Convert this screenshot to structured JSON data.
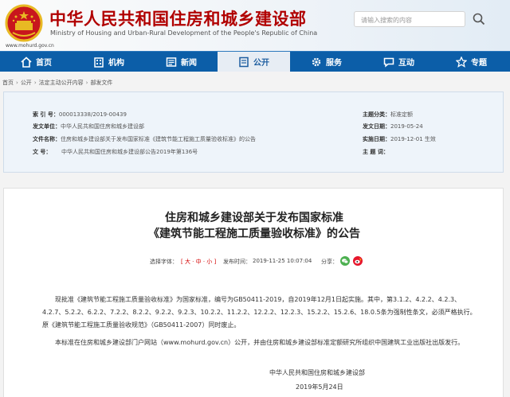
{
  "header": {
    "title": "中华人民共和国住房和城乡建设部",
    "subtitle": "Ministry of Housing and Urban-Rural Development of the People's Republic of China",
    "url": "www.mohurd.gov.cn",
    "search_placeholder": "请输入搜索的内容"
  },
  "nav": {
    "items": [
      {
        "label": "首页",
        "icon": "home-icon"
      },
      {
        "label": "机构",
        "icon": "building-icon"
      },
      {
        "label": "新闻",
        "icon": "news-icon"
      },
      {
        "label": "公开",
        "icon": "document-icon",
        "active": true
      },
      {
        "label": "服务",
        "icon": "gear-icon"
      },
      {
        "label": "互动",
        "icon": "chat-icon"
      },
      {
        "label": "专题",
        "icon": "star-icon"
      }
    ]
  },
  "breadcrumb": [
    "首页",
    "公开",
    "法定主动公开内容",
    "部发文件"
  ],
  "info": {
    "index_label": "索 引 号：",
    "index_value": "000013338/2019-00439",
    "issuer_label": "发文单位：",
    "issuer_value": "中华人民共和国住房和城乡建设部",
    "filename_label": "文件名称：",
    "filename_value": "住房和城乡建设部关于发布国家标准《建筑节能工程施工质量验收标准》的公告",
    "docno_label": "文 号：",
    "docno_value": "中华人民共和国住房和城乡建设部公告2019年第136号",
    "category_label": "主题分类：",
    "category_value": "标准定额",
    "date_label": "发文日期：",
    "date_value": "2019-05-24",
    "effective_label": "实施日期：",
    "effective_value": "2019-12-01 生效",
    "subject_label": "主 题 词：",
    "subject_value": ""
  },
  "article": {
    "title_line1": "住房和城乡建设部关于发布国家标准",
    "title_line2": "《建筑节能工程施工质量验收标准》的公告",
    "font_label": "选择字体：",
    "font_options": "[ 大 · 中 · 小 ]",
    "publish_label": "发布时间：",
    "publish_time": "2019-11-25 10:07:04",
    "share_label": "分享：",
    "paragraph1": "现批准《建筑节能工程施工质量验收标准》为国家标准，编号为GB50411-2019，自2019年12月1日起实施。其中，第3.1.2、4.2.2、4.2.3、4.2.7、5.2.2、6.2.2、7.2.2、8.2.2、9.2.2、9.2.3、10.2.2、11.2.2、12.2.2、12.2.3、15.2.2、15.2.6、18.0.5条为强制性条文，必须严格执行。原《建筑节能工程施工质量验收规范》（GB50411-2007）同时废止。",
    "paragraph2": "本标准在住房和城乡建设部门户网站（www.mohurd.gov.cn）公开，并由住房和城乡建设部标准定额研究所组织中国建筑工业出版社出版发行。",
    "signature": "中华人民共和国住房和城乡建设部",
    "sign_date": "2019年5月24日"
  },
  "colors": {
    "brand_red": "#b10000",
    "nav_blue": "#0c5ea8",
    "info_bg": "#eef4fa"
  }
}
